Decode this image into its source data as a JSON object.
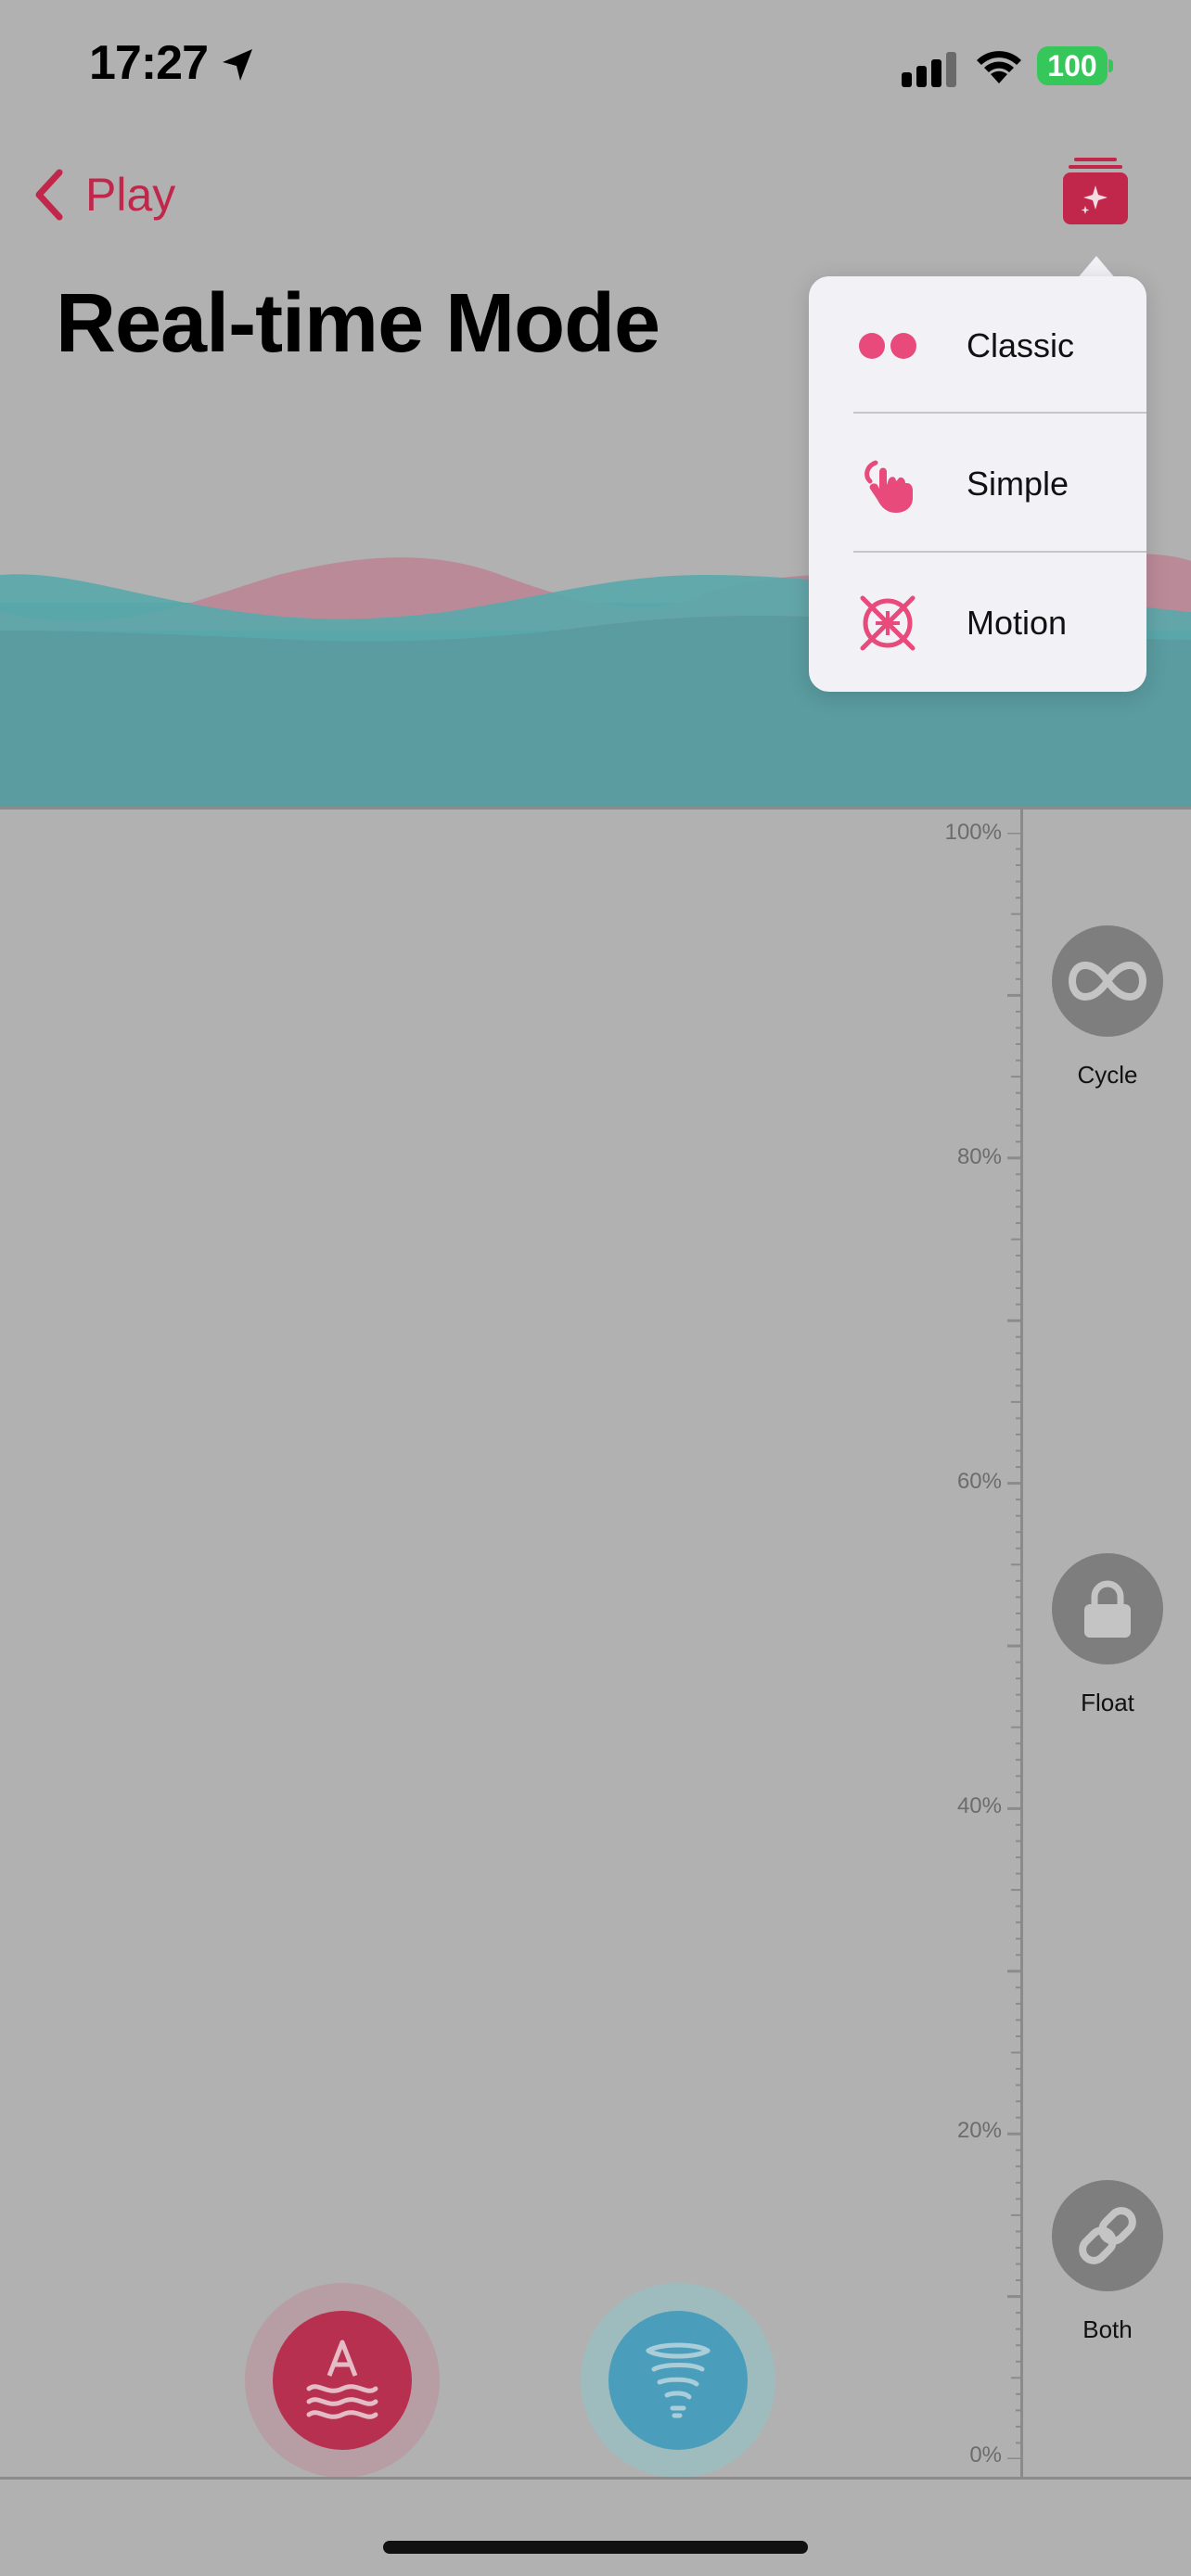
{
  "status_bar": {
    "time": "17:27",
    "battery": "100",
    "icons": [
      "location-arrow-icon",
      "cellular-signal-icon",
      "wifi-icon",
      "battery-icon"
    ]
  },
  "nav": {
    "back_label": "Play",
    "mode_button_icon": "sparkle-stack-icon"
  },
  "page": {
    "title": "Real-time Mode"
  },
  "mode_menu": {
    "items": [
      {
        "label": "Classic",
        "icon": "two-dots-icon"
      },
      {
        "label": "Simple",
        "icon": "hand-tap-icon"
      },
      {
        "label": "Motion",
        "icon": "crosshair-x-icon"
      }
    ]
  },
  "scale": {
    "labels": [
      "100%",
      "80%",
      "60%",
      "40%",
      "20%",
      "0%"
    ]
  },
  "side_controls": [
    {
      "label": "Cycle",
      "icon": "infinity-icon"
    },
    {
      "label": "Float",
      "icon": "lock-icon"
    },
    {
      "label": "Both",
      "icon": "link-icon"
    }
  ],
  "bottom_controls": [
    {
      "name": "waves-a-button",
      "icon": "letter-a-waves-icon",
      "color": "#b8304f"
    },
    {
      "name": "tornado-button",
      "icon": "tornado-icon",
      "color": "#4a9dbb"
    }
  ],
  "colors": {
    "accent": "#c0274b",
    "wave_teal": "#5a9ca0",
    "wave_pink": "#bb8a99",
    "background": "#b1b1b1"
  }
}
